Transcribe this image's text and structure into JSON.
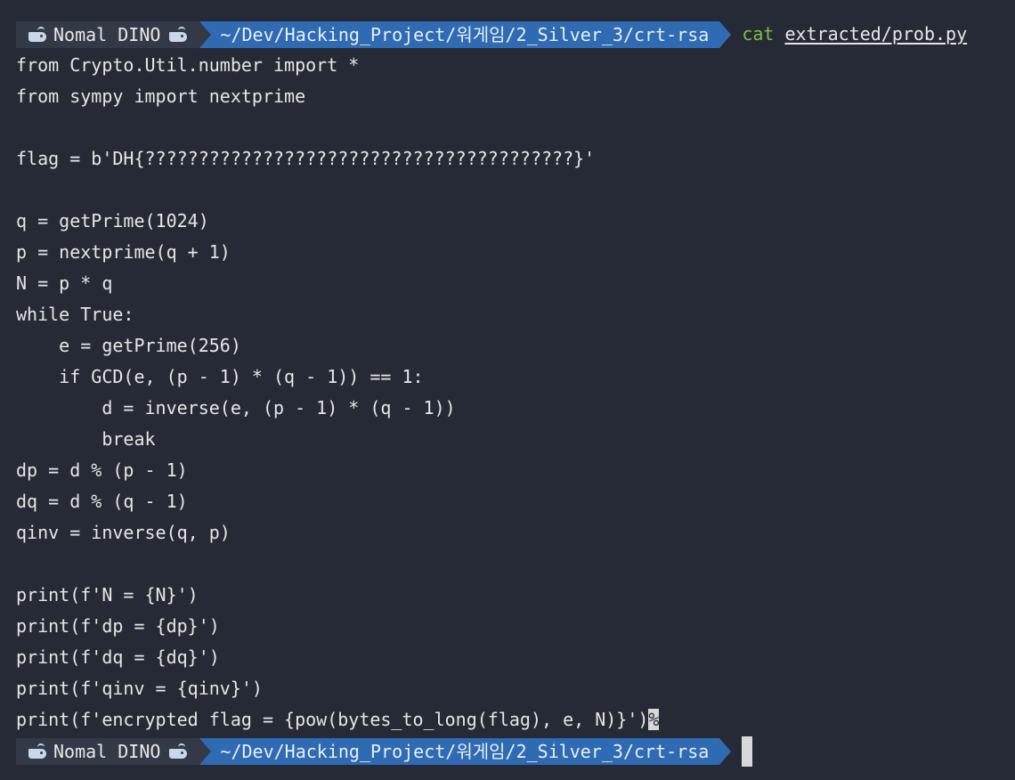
{
  "prompt": {
    "user": "Nomal DINO",
    "left_icon": "whale-icon",
    "right_icon": "whale-icon",
    "path": "~/Dev/Hacking_Project/워게임/2_Silver_3/crt-rsa",
    "user_bg": "#343947",
    "path_bg": "#2f6bb3"
  },
  "command": {
    "name": "cat",
    "argument": "extracted/prob.py",
    "name_color": "#7ac142"
  },
  "output_lines": [
    "from Crypto.Util.number import *",
    "from sympy import nextprime",
    "",
    "flag = b'DH{????????????????????????????????????????}'",
    "",
    "q = getPrime(1024)",
    "p = nextprime(q + 1)",
    "N = p * q",
    "while True:",
    "    e = getPrime(256)",
    "    if GCD(e, (p - 1) * (q - 1)) == 1:",
    "        d = inverse(e, (p - 1) * (q - 1))",
    "        break",
    "dp = d % (p - 1)",
    "dq = d % (q - 1)",
    "qinv = inverse(q, p)",
    "",
    "print(f'N = {N}')",
    "print(f'dp = {dp}')",
    "print(f'dq = {dq}')",
    "print(f'qinv = {qinv}')",
    "print(f'encrypted flag = {pow(bytes_to_long(flag), e, N)}')"
  ],
  "no_newline_marker": "%"
}
